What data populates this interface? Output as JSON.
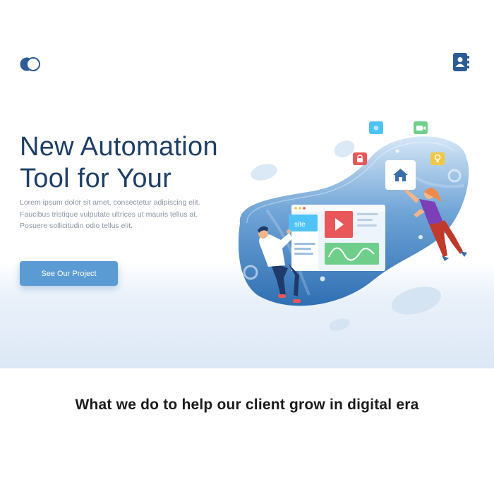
{
  "header": {
    "logo_icon": "toggle-circles-logo",
    "contacts_icon": "contact-book-icon"
  },
  "hero": {
    "headline_line1": "New Automation",
    "headline_line2": "Tool for Your",
    "description": "Lorem ipsum dolor sit amet, consectetur adipiscing elit. Faucibus tristique vulputate ultrices ut mauris tellus at. Posuere sollicitudin odio tellus elit.",
    "cta_label": "See Our Project",
    "illustration": {
      "browser_tag": "site",
      "floating_icons": [
        "snowflake-icon",
        "video-camera-icon",
        "lock-icon",
        "lightbulb-icon",
        "home-icon"
      ]
    }
  },
  "section": {
    "tagline": "What we do to help our client grow in digital era"
  },
  "colors": {
    "brand_dark": "#1e3f66",
    "accent_blue": "#5b9bd3",
    "icon_red": "#e8575a",
    "icon_green": "#6fcf8a",
    "icon_yellow": "#f3c746",
    "icon_cyan": "#4fc3f7"
  }
}
